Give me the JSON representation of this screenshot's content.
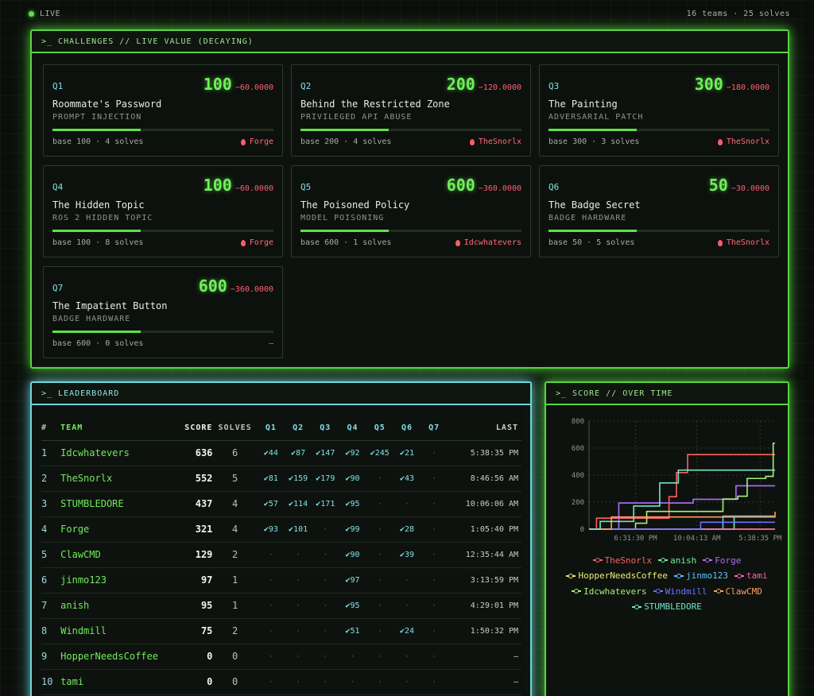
{
  "topbar": {
    "live_label": "LIVE",
    "stats": "16 teams · 25 solves"
  },
  "challenges": {
    "header": ">_ CHALLENGES // LIVE VALUE (DECAYING)",
    "items": [
      {
        "id": "Q1",
        "value": "100",
        "decay": "−60.0000",
        "title": "Roommate's Password",
        "category": "PROMPT INJECTION",
        "meta": "base 100 · 4 solves",
        "first_blood": "Forge"
      },
      {
        "id": "Q2",
        "value": "200",
        "decay": "−120.0000",
        "title": "Behind the Restricted Zone",
        "category": "PRIVILEGED API ABUSE",
        "meta": "base 200 · 4 solves",
        "first_blood": "TheSnorlx"
      },
      {
        "id": "Q3",
        "value": "300",
        "decay": "−180.0000",
        "title": "The Painting",
        "category": "ADVERSARIAL PATCH",
        "meta": "base 300 · 3 solves",
        "first_blood": "TheSnorlx"
      },
      {
        "id": "Q4",
        "value": "100",
        "decay": "−60.0000",
        "title": "The Hidden Topic",
        "category": "ROS 2 HIDDEN TOPIC",
        "meta": "base 100 · 8 solves",
        "first_blood": "Forge"
      },
      {
        "id": "Q5",
        "value": "600",
        "decay": "−360.0000",
        "title": "The Poisoned Policy",
        "category": "MODEL POISONING",
        "meta": "base 600 · 1 solves",
        "first_blood": "Idcwhatevers"
      },
      {
        "id": "Q6",
        "value": "50",
        "decay": "−30.0000",
        "title": "The Badge Secret",
        "category": "BADGE HARDWARE",
        "meta": "base 50 · 5 solves",
        "first_blood": "TheSnorlx"
      },
      {
        "id": "Q7",
        "value": "600",
        "decay": "−360.0000",
        "title": "The Impatient Button",
        "category": "BADGE HARDWARE",
        "meta": "base 600 · 0 solves",
        "first_blood": "–"
      }
    ]
  },
  "leaderboard": {
    "header": ">_ LEADERBOARD",
    "columns": [
      "#",
      "TEAM",
      "SCORE",
      "SOLVES",
      "Q1",
      "Q2",
      "Q3",
      "Q4",
      "Q5",
      "Q6",
      "Q7",
      "LAST"
    ],
    "rows": [
      {
        "rank": "1",
        "team": "Idcwhatevers",
        "score": "636",
        "solves": "6",
        "q": [
          "✔44",
          "✔87",
          "✔147",
          "✔92",
          "✔245",
          "✔21",
          "·"
        ],
        "last": "5:38:35 PM"
      },
      {
        "rank": "2",
        "team": "TheSnorlx",
        "score": "552",
        "solves": "5",
        "q": [
          "✔81",
          "✔159",
          "✔179",
          "✔90",
          "·",
          "✔43",
          "·"
        ],
        "last": "8:46:56 AM"
      },
      {
        "rank": "3",
        "team": "STUMBLEDORE",
        "score": "437",
        "solves": "4",
        "q": [
          "✔57",
          "✔114",
          "✔171",
          "✔95",
          "·",
          "·",
          "·"
        ],
        "last": "10:06:06 AM"
      },
      {
        "rank": "4",
        "team": "Forge",
        "score": "321",
        "solves": "4",
        "q": [
          "✔93",
          "✔101",
          "·",
          "✔99",
          "·",
          "✔28",
          "·"
        ],
        "last": "1:05:40 PM"
      },
      {
        "rank": "5",
        "team": "ClawCMD",
        "score": "129",
        "solves": "2",
        "q": [
          "·",
          "·",
          "·",
          "✔90",
          "·",
          "✔39",
          "·"
        ],
        "last": "12:35:44 AM"
      },
      {
        "rank": "6",
        "team": "jinmo123",
        "score": "97",
        "solves": "1",
        "q": [
          "·",
          "·",
          "·",
          "✔97",
          "·",
          "·",
          "·"
        ],
        "last": "3:13:59 PM"
      },
      {
        "rank": "7",
        "team": "anish",
        "score": "95",
        "solves": "1",
        "q": [
          "·",
          "·",
          "·",
          "✔95",
          "·",
          "·",
          "·"
        ],
        "last": "4:29:01 PM"
      },
      {
        "rank": "8",
        "team": "Windmill",
        "score": "75",
        "solves": "2",
        "q": [
          "·",
          "·",
          "·",
          "✔51",
          "·",
          "✔24",
          "·"
        ],
        "last": "1:50:32 PM"
      },
      {
        "rank": "9",
        "team": "HopperNeedsCoffee",
        "score": "0",
        "solves": "0",
        "q": [
          "·",
          "·",
          "·",
          "·",
          "·",
          "·",
          "·"
        ],
        "last": "–"
      },
      {
        "rank": "10",
        "team": "tami",
        "score": "0",
        "solves": "0",
        "q": [
          "·",
          "·",
          "·",
          "·",
          "·",
          "·",
          "·"
        ],
        "last": "–"
      }
    ]
  },
  "score_chart": {
    "header": ">_ SCORE // OVER TIME"
  },
  "chart_data": {
    "type": "line",
    "title": "",
    "xlabel": "",
    "ylabel": "",
    "ylim": [
      0,
      800
    ],
    "yticks": [
      "0",
      "200",
      "400",
      "600",
      "800"
    ],
    "xticks": [
      "6:31:30 PM",
      "10:04:13 AM",
      "5:38:35 PM"
    ],
    "grid": true,
    "legend": "bottom",
    "series": [
      {
        "name": "TheSnorlx",
        "color": "#ff5f5f",
        "points": [
          [
            0,
            0
          ],
          [
            0.04,
            81
          ],
          [
            0.43,
            240
          ],
          [
            0.47,
            419
          ],
          [
            0.53,
            552
          ],
          [
            1,
            552
          ]
        ]
      },
      {
        "name": "anish",
        "color": "#6ff0a0",
        "points": [
          [
            0,
            0
          ],
          [
            0.78,
            0
          ],
          [
            0.78,
            95
          ],
          [
            1,
            95
          ]
        ]
      },
      {
        "name": "Forge",
        "color": "#b06bff",
        "points": [
          [
            0,
            0
          ],
          [
            0.16,
            93
          ],
          [
            0.16,
            194
          ],
          [
            0.56,
            194
          ],
          [
            0.56,
            221
          ],
          [
            0.79,
            221
          ],
          [
            0.79,
            321
          ],
          [
            1,
            321
          ]
        ]
      },
      {
        "name": "HopperNeedsCoffee",
        "color": "#e8ec7a",
        "points": [
          [
            0,
            0
          ],
          [
            1,
            0
          ]
        ]
      },
      {
        "name": "jinmo123",
        "color": "#5fc0ff",
        "points": [
          [
            0,
            0
          ],
          [
            0.72,
            0
          ],
          [
            0.72,
            97
          ],
          [
            1,
            97
          ]
        ]
      },
      {
        "name": "tami",
        "color": "#ff5fb0",
        "points": [
          [
            0,
            0
          ],
          [
            1,
            0
          ]
        ]
      },
      {
        "name": "Idcwhatevers",
        "color": "#a6f07a",
        "points": [
          [
            0,
            0
          ],
          [
            0.25,
            44
          ],
          [
            0.31,
            131
          ],
          [
            0.72,
            131
          ],
          [
            0.72,
            223
          ],
          [
            0.8,
            223
          ],
          [
            0.8,
            244
          ],
          [
            0.85,
            244
          ],
          [
            0.85,
            375
          ],
          [
            0.95,
            375
          ],
          [
            0.95,
            391
          ],
          [
            0.99,
            391
          ],
          [
            0.99,
            636
          ],
          [
            1,
            636
          ]
        ]
      },
      {
        "name": "Windmill",
        "color": "#6f6fff",
        "points": [
          [
            0,
            0
          ],
          [
            0.6,
            0
          ],
          [
            0.6,
            51
          ],
          [
            1,
            51
          ]
        ]
      },
      {
        "name": "ClawCMD",
        "color": "#ff9d5f",
        "points": [
          [
            0,
            0
          ],
          [
            0.12,
            0
          ],
          [
            0.12,
            90
          ],
          [
            1,
            129
          ]
        ]
      },
      {
        "name": "STUMBLEDORE",
        "color": "#6fe6c6",
        "points": [
          [
            0,
            0
          ],
          [
            0.06,
            57
          ],
          [
            0.24,
            57
          ],
          [
            0.24,
            171
          ],
          [
            0.38,
            171
          ],
          [
            0.38,
            342
          ],
          [
            0.48,
            342
          ],
          [
            0.48,
            437
          ],
          [
            1,
            437
          ]
        ]
      }
    ]
  }
}
